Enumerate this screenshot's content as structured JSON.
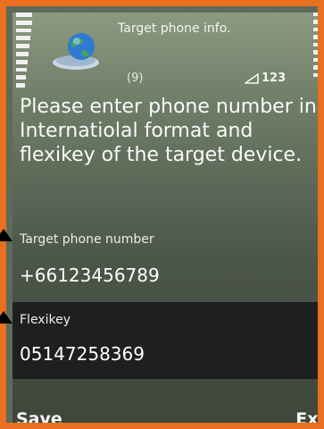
{
  "header": {
    "title": "Target phone info.",
    "counter": "(9)",
    "message_count": "123"
  },
  "prompt_text": "Please enter phone number in Internatiolal format and flexikey of the target device.",
  "fields": {
    "phone": {
      "label": "Target phone number",
      "value": "+66123456789"
    },
    "flexikey": {
      "label": "Flexikey",
      "value": "05147258369"
    }
  },
  "softkeys": {
    "left": "Save",
    "right": "Exi"
  },
  "colors": {
    "frame": "#e8701e",
    "focused_field_bg": "#1e201f"
  }
}
